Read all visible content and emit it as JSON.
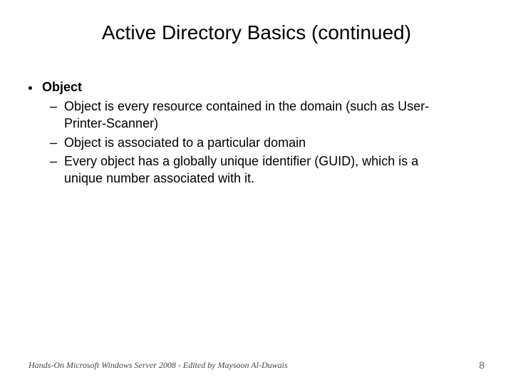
{
  "title": "Active Directory Basics (continued)",
  "bullet": {
    "heading": "Object",
    "subitems": [
      "Object is every resource contained in the domain (such as User-Printer-Scanner)",
      "Object is associated to a particular domain",
      "Every object has a globally unique identifier (GUID), which is a unique number associated with it."
    ]
  },
  "footer": {
    "text": "Hands-On Microsoft Windows Server 2008 - Edited by Maysoon Al-Duwais",
    "page": "8"
  }
}
